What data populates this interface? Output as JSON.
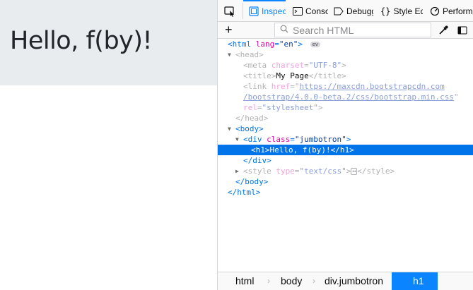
{
  "page": {
    "heading": "Hello, f(by)!"
  },
  "devtools": {
    "tabs": [
      {
        "label": "Inspector",
        "selected": true
      },
      {
        "label": "Console"
      },
      {
        "label": "Debugger"
      },
      {
        "label": "Style Editor"
      },
      {
        "label": "Performance"
      }
    ],
    "search": {
      "placeholder": "Search HTML",
      "value": ""
    },
    "markup": {
      "html_open": {
        "tag": "html",
        "attr": "lang",
        "value": "\"en\"",
        "badge": "ev"
      },
      "head_open": "head",
      "meta": {
        "tag": "meta",
        "attr": "charset",
        "value": "\"UTF-8\""
      },
      "title": {
        "tag": "title",
        "text": "My Page"
      },
      "link": {
        "tag": "link",
        "attr": "href",
        "url_line1": "https://maxcdn.bootstrapcdn.com",
        "url_line2": "/bootstrap/4.0.0-beta.2/css/bootstrap.min.css",
        "rel_attr": "rel",
        "rel_value": "\"stylesheet\""
      },
      "head_close": "head",
      "body_open": "body",
      "div_open": {
        "tag": "div",
        "attr": "class",
        "value": "\"jumbotron\""
      },
      "h1": {
        "tag": "h1",
        "text": "Hello, f(by)!"
      },
      "div_close": "div",
      "style": {
        "tag": "style",
        "attr": "type",
        "value": "\"text/css\"",
        "ellipsis": "⋯"
      },
      "body_close": "body",
      "html_close": "html"
    },
    "breadcrumbs": [
      "html",
      "body",
      "div.jumbotron",
      "h1"
    ]
  }
}
